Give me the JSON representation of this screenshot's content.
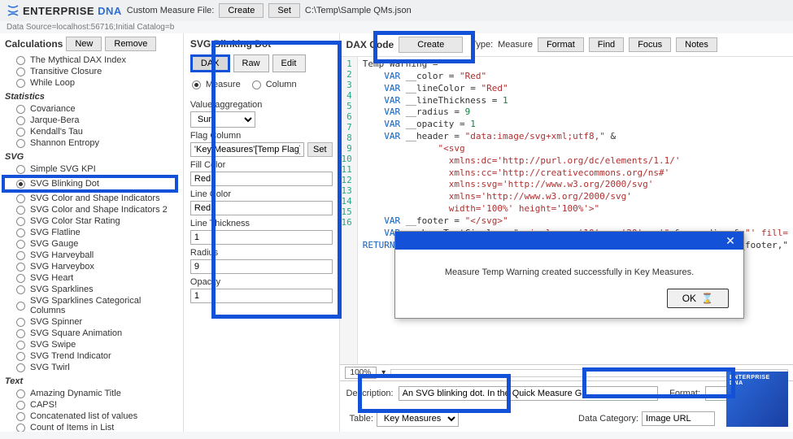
{
  "brand": {
    "name1": "ENTERPRISE",
    "name2": "DNA"
  },
  "topbar": {
    "custom_label": "Custom Measure File:",
    "create_btn": "Create",
    "set_btn": "Set",
    "filepath": "C:\\Temp\\Sample QMs.json"
  },
  "datasource": "Data Source=localhost:56716;Initial Catalog=b",
  "sidebar": {
    "title": "Calculations",
    "new_btn": "New",
    "remove_btn": "Remove",
    "groups": [
      {
        "title": null,
        "items": [
          {
            "label": "The Mythical DAX Index",
            "sel": false
          },
          {
            "label": "Transitive Closure",
            "sel": false
          },
          {
            "label": "While Loop",
            "sel": false
          }
        ]
      },
      {
        "title": "Statistics",
        "items": [
          {
            "label": "Covariance",
            "sel": false
          },
          {
            "label": "Jarque-Bera",
            "sel": false
          },
          {
            "label": "Kendall's Tau",
            "sel": false
          },
          {
            "label": "Shannon Entropy",
            "sel": false
          }
        ]
      },
      {
        "title": "SVG",
        "items": [
          {
            "label": "Simple SVG KPI",
            "sel": false
          },
          {
            "label": "SVG Blinking Dot",
            "sel": true,
            "hl": true
          },
          {
            "label": "SVG Color and Shape Indicators",
            "sel": false
          },
          {
            "label": "SVG Color and Shape Indicators 2",
            "sel": false
          },
          {
            "label": "SVG Color Star Rating",
            "sel": false
          },
          {
            "label": "SVG Flatline",
            "sel": false
          },
          {
            "label": "SVG Gauge",
            "sel": false
          },
          {
            "label": "SVG Harveyball",
            "sel": false
          },
          {
            "label": "SVG Harveybox",
            "sel": false
          },
          {
            "label": "SVG Heart",
            "sel": false
          },
          {
            "label": "SVG Sparklines",
            "sel": false
          },
          {
            "label": "SVG Sparklines Categorical Columns",
            "sel": false
          },
          {
            "label": "SVG Spinner",
            "sel": false
          },
          {
            "label": "SVG Square Animation",
            "sel": false
          },
          {
            "label": "SVG Swipe",
            "sel": false
          },
          {
            "label": "SVG Trend Indicator",
            "sel": false
          },
          {
            "label": "SVG Twirl",
            "sel": false
          }
        ]
      },
      {
        "title": "Text",
        "items": [
          {
            "label": "Amazing Dynamic Title",
            "sel": false
          },
          {
            "label": "CAPS!",
            "sel": false
          },
          {
            "label": "Concatenated list of values",
            "sel": false
          },
          {
            "label": "Count of Items in List",
            "sel": false
          }
        ]
      }
    ]
  },
  "center": {
    "title": "SVG Blinking Dot",
    "tabs": {
      "dax": "DAX",
      "raw": "Raw",
      "edit": "Edit"
    },
    "kind": {
      "measure": "Measure",
      "column": "Column",
      "sel": "measure"
    },
    "val_agg_label": "Value aggregation",
    "val_agg_value": "Sum",
    "flag_label": "Flag Column",
    "flag_value": "'Key Measures'[Temp Flag]",
    "set_btn": "Set",
    "fill_label": "Fill Color",
    "fill_value": "Red",
    "line_label": "Line Color",
    "line_value": "Red",
    "thick_label": "Line Thickness",
    "thick_value": "1",
    "radius_label": "Radius",
    "radius_value": "9",
    "opacity_label": "Opacity",
    "opacity_value": "1"
  },
  "code": {
    "title": "DAX Code",
    "create_btn": "Create",
    "type_label": "Type:",
    "type_value": "Measure",
    "format_btn": "Format",
    "find_btn": "Find",
    "focus_btn": "Focus",
    "notes_btn": "Notes",
    "zoom": "100%"
  },
  "description_label": "Description:",
  "description_value": "An SVG blinking dot. In the Quick Measure Ga",
  "format_label": "Format:",
  "table_label": "Table:",
  "table_value": "Key Measures",
  "datacat_label": "Data Category:",
  "datacat_value": "Image URL",
  "modal": {
    "message": "Measure Temp Warning created successfully in Key Measures.",
    "ok": "OK"
  },
  "promo": "ENTERPRISE DNA"
}
